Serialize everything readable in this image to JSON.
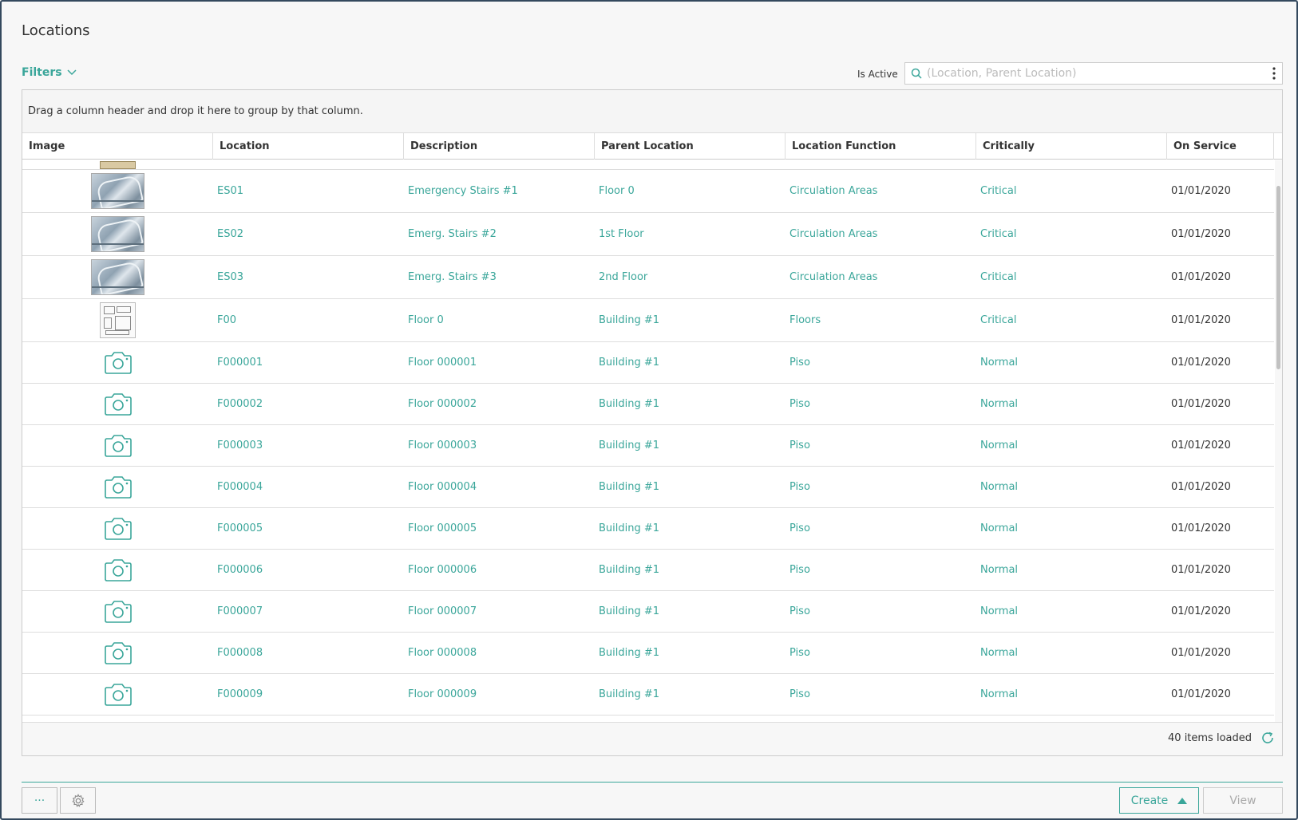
{
  "page": {
    "title": "Locations"
  },
  "filters": {
    "label": "Filters"
  },
  "search": {
    "is_active_label": "Is Active",
    "placeholder": "(Location, Parent Location)",
    "value": ""
  },
  "grid": {
    "group_hint": "Drag a column header and drop it here to group by that column.",
    "columns": [
      "Image",
      "Location",
      "Description",
      "Parent Location",
      "Location Function",
      "Critically",
      "On Service"
    ],
    "rows": [
      {
        "image": "stairs-photo",
        "location": "ES01",
        "description": "Emergency Stairs #1",
        "parent": "Floor 0",
        "function": "Circulation Areas",
        "criticality": "Critical",
        "on_service": "01/01/2020"
      },
      {
        "image": "stairs-photo",
        "location": "ES02",
        "description": "Emerg. Stairs #2",
        "parent": "1st Floor",
        "function": "Circulation Areas",
        "criticality": "Critical",
        "on_service": "01/01/2020"
      },
      {
        "image": "stairs-photo",
        "location": "ES03",
        "description": "Emerg. Stairs #3",
        "parent": "2nd Floor",
        "function": "Circulation Areas",
        "criticality": "Critical",
        "on_service": "01/01/2020"
      },
      {
        "image": "floor-plan",
        "location": "F00",
        "description": "Floor 0",
        "parent": "Building #1",
        "function": "Floors",
        "criticality": "Critical",
        "on_service": "01/01/2020"
      },
      {
        "image": "camera-icon",
        "location": "F000001",
        "description": "Floor 000001",
        "parent": "Building #1",
        "function": "Piso",
        "criticality": "Normal",
        "on_service": "01/01/2020"
      },
      {
        "image": "camera-icon",
        "location": "F000002",
        "description": "Floor 000002",
        "parent": "Building #1",
        "function": "Piso",
        "criticality": "Normal",
        "on_service": "01/01/2020"
      },
      {
        "image": "camera-icon",
        "location": "F000003",
        "description": "Floor 000003",
        "parent": "Building #1",
        "function": "Piso",
        "criticality": "Normal",
        "on_service": "01/01/2020"
      },
      {
        "image": "camera-icon",
        "location": "F000004",
        "description": "Floor 000004",
        "parent": "Building #1",
        "function": "Piso",
        "criticality": "Normal",
        "on_service": "01/01/2020"
      },
      {
        "image": "camera-icon",
        "location": "F000005",
        "description": "Floor 000005",
        "parent": "Building #1",
        "function": "Piso",
        "criticality": "Normal",
        "on_service": "01/01/2020"
      },
      {
        "image": "camera-icon",
        "location": "F000006",
        "description": "Floor 000006",
        "parent": "Building #1",
        "function": "Piso",
        "criticality": "Normal",
        "on_service": "01/01/2020"
      },
      {
        "image": "camera-icon",
        "location": "F000007",
        "description": "Floor 000007",
        "parent": "Building #1",
        "function": "Piso",
        "criticality": "Normal",
        "on_service": "01/01/2020"
      },
      {
        "image": "camera-icon",
        "location": "F000008",
        "description": "Floor 000008",
        "parent": "Building #1",
        "function": "Piso",
        "criticality": "Normal",
        "on_service": "01/01/2020"
      },
      {
        "image": "camera-icon",
        "location": "F000009",
        "description": "Floor 000009",
        "parent": "Building #1",
        "function": "Piso",
        "criticality": "Normal",
        "on_service": "01/01/2020"
      }
    ],
    "status": "40 items loaded"
  },
  "toolbar": {
    "more_label": "···",
    "create_label": "Create",
    "view_label": "View"
  },
  "colors": {
    "accent": "#3aa69a",
    "border": "#34495e"
  }
}
